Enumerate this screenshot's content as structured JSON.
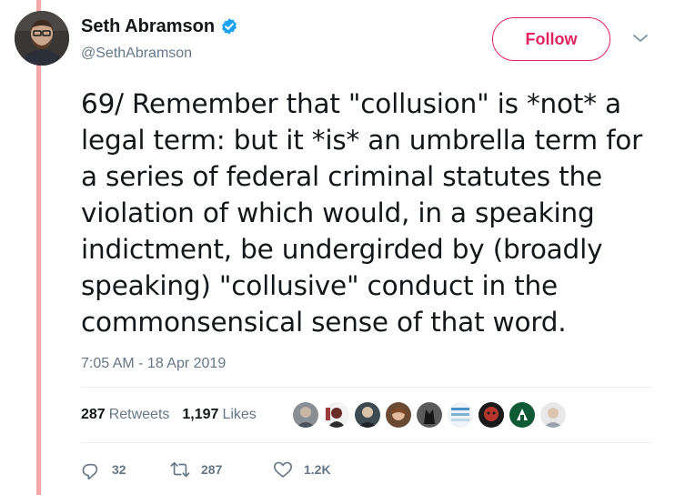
{
  "author": {
    "name": "Seth Abramson",
    "handle": "@SethAbramson",
    "verified": true
  },
  "follow_button": {
    "label": "Follow",
    "color": "#e0245e"
  },
  "tweet": {
    "text": "69/ Remember that \"collusion\" is *not* a legal term: but it *is* an umbrella term for a series of federal criminal statutes the violation of which would, in a speaking indictment, be undergirded by (broadly speaking) \"collusive\" conduct in the commonsensical sense of that word.",
    "timestamp": "7:05 AM - 18 Apr 2019"
  },
  "stats": {
    "retweets_count": "287",
    "retweets_label": "Retweets",
    "likes_count": "1,197",
    "likes_label": "Likes"
  },
  "actions": {
    "reply_count": "32",
    "retweet_count": "287",
    "like_count": "1.2K"
  },
  "icons": {
    "verified": "verified-badge-icon",
    "caret": "chevron-down-icon",
    "reply": "reply-icon",
    "retweet": "retweet-icon",
    "like": "heart-icon"
  },
  "colors": {
    "thread_line": "#f4a9a8",
    "verified": "#1da1f2",
    "secondary_text": "#657786"
  }
}
